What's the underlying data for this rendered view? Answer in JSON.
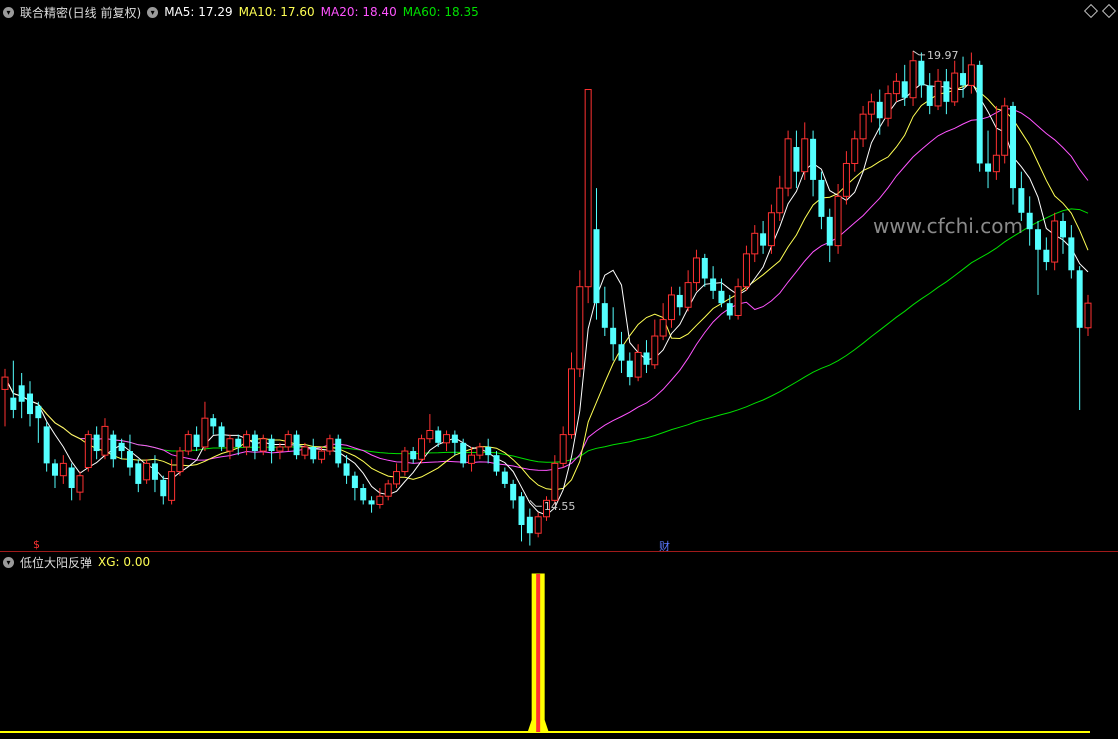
{
  "header": {
    "title": "联合精密(日线 前复权)",
    "ma5": "MA5: 17.29",
    "ma10": "MA10: 17.60",
    "ma20": "MA20: 18.40",
    "ma60": "MA60: 18.35"
  },
  "indicator": {
    "name": "低位大阳反弹",
    "xg": "XG: 0.00"
  },
  "markers": {
    "low_label": "14.55",
    "high_label": "19.97",
    "fin_marker": "财",
    "s_marker": "$",
    "watermark": "www.cfchi.com"
  },
  "colors": {
    "up": "#ff3232",
    "down": "#54ffff",
    "ma5": "#ffffff",
    "ma10": "#ffff54",
    "ma20": "#ff54ff",
    "ma60": "#00e000",
    "signal": "#ffff00",
    "divider": "#a01a1a"
  },
  "chart_data": {
    "type": "candlestick",
    "ylim": [
      14.2,
      20.2
    ],
    "high_value": 19.97,
    "low_value": 14.55,
    "ma_last": {
      "MA5": 17.29,
      "MA10": 17.6,
      "MA20": 18.4,
      "MA60": 18.35
    },
    "candles": [
      [
        15.85,
        16.0,
        15.4,
        16.1
      ],
      [
        15.75,
        15.6,
        15.5,
        16.2
      ],
      [
        15.9,
        15.7,
        15.5,
        16.05
      ],
      [
        15.8,
        15.55,
        15.4,
        15.95
      ],
      [
        15.65,
        15.5,
        15.2,
        15.7
      ],
      [
        15.4,
        14.95,
        14.85,
        15.45
      ],
      [
        14.95,
        14.8,
        14.65,
        15.0
      ],
      [
        14.8,
        14.95,
        14.7,
        15.05
      ],
      [
        14.9,
        14.65,
        14.5,
        14.95
      ],
      [
        14.6,
        14.8,
        14.5,
        14.85
      ],
      [
        14.9,
        15.3,
        14.85,
        15.35
      ],
      [
        15.3,
        15.1,
        15.0,
        15.4
      ],
      [
        15.05,
        15.4,
        15.0,
        15.5
      ],
      [
        15.3,
        15.0,
        14.9,
        15.35
      ],
      [
        15.2,
        15.1,
        15.0,
        15.25
      ],
      [
        15.1,
        14.9,
        14.8,
        15.3
      ],
      [
        14.95,
        14.7,
        14.6,
        15.0
      ],
      [
        14.75,
        14.95,
        14.7,
        15.0
      ],
      [
        14.95,
        14.75,
        14.6,
        15.05
      ],
      [
        14.75,
        14.55,
        14.45,
        14.8
      ],
      [
        14.5,
        14.85,
        14.45,
        15.0
      ],
      [
        14.85,
        15.1,
        14.8,
        15.15
      ],
      [
        15.1,
        15.3,
        15.05,
        15.35
      ],
      [
        15.3,
        15.15,
        15.1,
        15.4
      ],
      [
        15.15,
        15.5,
        15.1,
        15.7
      ],
      [
        15.5,
        15.4,
        15.3,
        15.55
      ],
      [
        15.4,
        15.15,
        15.1,
        15.45
      ],
      [
        15.1,
        15.25,
        15.0,
        15.3
      ],
      [
        15.25,
        15.15,
        15.05,
        15.3
      ],
      [
        15.15,
        15.3,
        15.05,
        15.35
      ],
      [
        15.3,
        15.1,
        15.0,
        15.35
      ],
      [
        15.1,
        15.25,
        15.05,
        15.3
      ],
      [
        15.25,
        15.1,
        14.95,
        15.3
      ],
      [
        15.1,
        15.15,
        15.0,
        15.2
      ],
      [
        15.15,
        15.3,
        15.1,
        15.35
      ],
      [
        15.3,
        15.05,
        15.0,
        15.35
      ],
      [
        15.05,
        15.15,
        15.0,
        15.2
      ],
      [
        15.15,
        15.0,
        14.95,
        15.25
      ],
      [
        15.0,
        15.1,
        14.95,
        15.15
      ],
      [
        15.1,
        15.25,
        15.05,
        15.3
      ],
      [
        15.25,
        14.95,
        14.9,
        15.3
      ],
      [
        14.95,
        14.8,
        14.7,
        15.05
      ],
      [
        14.8,
        14.65,
        14.5,
        14.85
      ],
      [
        14.65,
        14.5,
        14.45,
        14.7
      ],
      [
        14.5,
        14.45,
        14.35,
        14.55
      ],
      [
        14.45,
        14.55,
        14.4,
        14.65
      ],
      [
        14.55,
        14.7,
        14.5,
        14.75
      ],
      [
        14.7,
        14.85,
        14.65,
        14.95
      ],
      [
        14.85,
        15.1,
        14.8,
        15.15
      ],
      [
        15.1,
        15.0,
        14.95,
        15.15
      ],
      [
        15.0,
        15.25,
        14.95,
        15.3
      ],
      [
        15.25,
        15.35,
        15.2,
        15.55
      ],
      [
        15.35,
        15.2,
        15.15,
        15.4
      ],
      [
        15.2,
        15.3,
        15.1,
        15.35
      ],
      [
        15.3,
        15.2,
        15.05,
        15.35
      ],
      [
        15.2,
        14.95,
        14.9,
        15.25
      ],
      [
        14.95,
        15.05,
        14.85,
        15.15
      ],
      [
        15.05,
        15.15,
        15.0,
        15.2
      ],
      [
        15.15,
        15.05,
        14.95,
        15.25
      ],
      [
        15.05,
        14.85,
        14.8,
        15.1
      ],
      [
        14.85,
        14.7,
        14.65,
        14.9
      ],
      [
        14.7,
        14.5,
        14.4,
        14.75
      ],
      [
        14.55,
        14.2,
        14.0,
        14.6
      ],
      [
        14.3,
        14.1,
        13.95,
        14.4
      ],
      [
        14.1,
        14.3,
        14.05,
        14.35
      ],
      [
        14.3,
        14.5,
        14.25,
        14.55
      ],
      [
        14.5,
        14.95,
        14.45,
        15.05
      ],
      [
        14.95,
        15.3,
        14.9,
        15.4
      ],
      [
        15.3,
        16.1,
        15.25,
        16.3
      ],
      [
        16.1,
        17.1,
        16.0,
        17.3
      ],
      [
        17.1,
        19.5,
        16.9,
        19.5
      ],
      [
        17.8,
        16.9,
        16.7,
        18.3
      ],
      [
        16.9,
        16.6,
        16.5,
        17.1
      ],
      [
        16.6,
        16.4,
        16.2,
        16.85
      ],
      [
        16.4,
        16.2,
        16.05,
        16.55
      ],
      [
        16.2,
        16.0,
        15.9,
        16.3
      ],
      [
        16.0,
        16.3,
        15.95,
        16.4
      ],
      [
        16.3,
        16.15,
        16.05,
        16.45
      ],
      [
        16.15,
        16.5,
        16.1,
        16.7
      ],
      [
        16.5,
        16.7,
        16.45,
        16.9
      ],
      [
        16.7,
        17.0,
        16.6,
        17.1
      ],
      [
        17.0,
        16.85,
        16.75,
        17.1
      ],
      [
        16.85,
        17.15,
        16.8,
        17.3
      ],
      [
        17.15,
        17.45,
        17.05,
        17.55
      ],
      [
        17.45,
        17.2,
        17.1,
        17.5
      ],
      [
        17.2,
        17.05,
        16.95,
        17.35
      ],
      [
        17.05,
        16.9,
        16.85,
        17.2
      ],
      [
        16.9,
        16.75,
        16.7,
        17.0
      ],
      [
        16.75,
        17.1,
        16.7,
        17.2
      ],
      [
        17.1,
        17.5,
        17.05,
        17.6
      ],
      [
        17.5,
        17.75,
        17.4,
        17.85
      ],
      [
        17.75,
        17.6,
        17.5,
        17.9
      ],
      [
        17.6,
        18.0,
        17.5,
        18.1
      ],
      [
        18.0,
        18.3,
        17.9,
        18.45
      ],
      [
        18.3,
        18.9,
        18.2,
        19.0
      ],
      [
        18.8,
        18.5,
        18.3,
        19.0
      ],
      [
        18.5,
        18.9,
        18.4,
        19.1
      ],
      [
        18.9,
        18.4,
        18.2,
        19.0
      ],
      [
        18.4,
        17.95,
        17.8,
        18.5
      ],
      [
        17.95,
        17.6,
        17.4,
        18.05
      ],
      [
        17.6,
        18.2,
        17.5,
        18.35
      ],
      [
        18.2,
        18.6,
        18.1,
        18.75
      ],
      [
        18.6,
        18.9,
        18.5,
        19.0
      ],
      [
        18.9,
        19.2,
        18.8,
        19.3
      ],
      [
        19.2,
        19.35,
        19.1,
        19.45
      ],
      [
        19.35,
        19.15,
        18.95,
        19.5
      ],
      [
        19.15,
        19.45,
        19.05,
        19.55
      ],
      [
        19.45,
        19.6,
        19.35,
        19.7
      ],
      [
        19.6,
        19.4,
        19.3,
        19.8
      ],
      [
        19.4,
        19.85,
        19.3,
        19.97
      ],
      [
        19.85,
        19.55,
        19.4,
        19.95
      ],
      [
        19.55,
        19.3,
        19.2,
        19.7
      ],
      [
        19.3,
        19.6,
        19.25,
        19.75
      ],
      [
        19.6,
        19.35,
        19.2,
        19.75
      ],
      [
        19.35,
        19.7,
        19.3,
        19.85
      ],
      [
        19.7,
        19.55,
        19.4,
        19.9
      ],
      [
        19.55,
        19.8,
        19.45,
        19.95
      ],
      [
        19.8,
        18.6,
        18.5,
        19.85
      ],
      [
        18.6,
        18.5,
        18.3,
        19.0
      ],
      [
        18.5,
        18.7,
        18.4,
        19.3
      ],
      [
        18.7,
        19.3,
        18.6,
        19.4
      ],
      [
        19.3,
        18.3,
        18.1,
        19.35
      ],
      [
        18.3,
        18.0,
        17.9,
        18.5
      ],
      [
        18.0,
        17.8,
        17.6,
        18.2
      ],
      [
        17.8,
        17.55,
        17.0,
        17.9
      ],
      [
        17.55,
        17.4,
        17.3,
        17.7
      ],
      [
        17.4,
        17.9,
        17.3,
        18.0
      ],
      [
        17.9,
        17.7,
        17.5,
        18.0
      ],
      [
        17.7,
        17.3,
        17.2,
        17.85
      ],
      [
        17.3,
        16.6,
        15.6,
        17.35
      ],
      [
        16.6,
        16.9,
        16.5,
        17.0
      ]
    ],
    "signal": {
      "type": "bar",
      "values_note": "signal spike at index 64-65",
      "spike_index": 64,
      "max": 1
    }
  }
}
